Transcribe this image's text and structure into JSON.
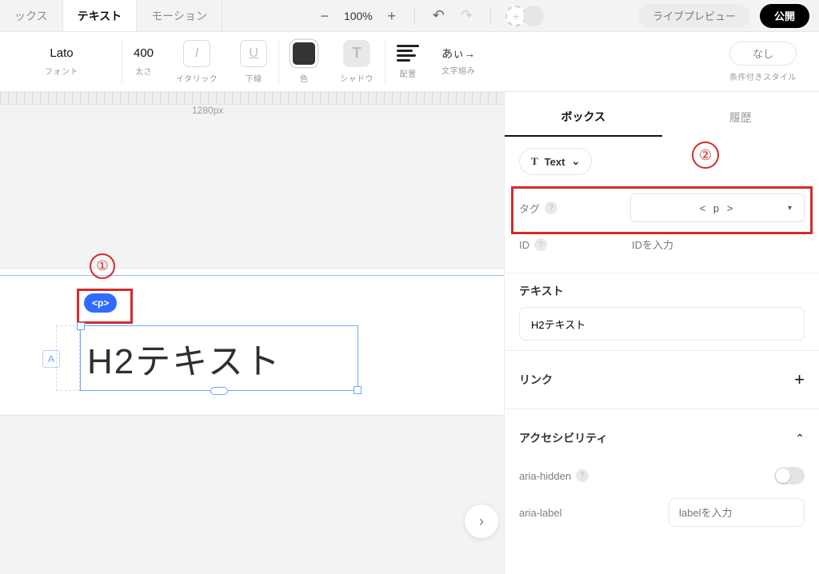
{
  "tabs": {
    "box": "ックス",
    "text": "テキスト",
    "motion": "モーション"
  },
  "zoom": {
    "value": "100%"
  },
  "top_buttons": {
    "preview": "ライブプレビュー",
    "publish": "公開"
  },
  "toolbar": {
    "font": {
      "value": "Lato",
      "label": "フォント"
    },
    "weight": {
      "value": "400",
      "label": "太さ"
    },
    "italic": {
      "glyph": "I",
      "label": "イタリック"
    },
    "underline": {
      "glyph": "U",
      "label": "下線"
    },
    "color": {
      "label": "色"
    },
    "shadow": {
      "glyph": "T",
      "label": "シャドウ"
    },
    "align": {
      "label": "配置"
    },
    "mojikumi": {
      "glyph": "あぃ→",
      "label": "文字組み"
    },
    "conditional": {
      "value": "なし",
      "label": "条件付きスタイル"
    }
  },
  "ruler": {
    "label": "1280px"
  },
  "annotations": {
    "one": "①",
    "two": "②"
  },
  "canvas": {
    "tag_badge": "<p>",
    "text": "H2テキスト",
    "a_icon": "A"
  },
  "expand_glyph": "›",
  "right": {
    "tabs": {
      "box": "ボックス",
      "history": "履歴"
    },
    "type_pill": {
      "icon": "T",
      "label": "Text",
      "caret": "⌄"
    },
    "props": {
      "tag": {
        "label": "タグ",
        "value": "< p >"
      },
      "id": {
        "label": "ID",
        "placeholder": "IDを入力"
      }
    },
    "text_section": {
      "title": "テキスト",
      "value": "H2テキスト"
    },
    "link_section": {
      "title": "リンク"
    },
    "a11y_section": {
      "title": "アクセシビリティ",
      "aria_hidden": "aria-hidden",
      "aria_label": "aria-label",
      "aria_label_placeholder": "labelを入力"
    }
  }
}
